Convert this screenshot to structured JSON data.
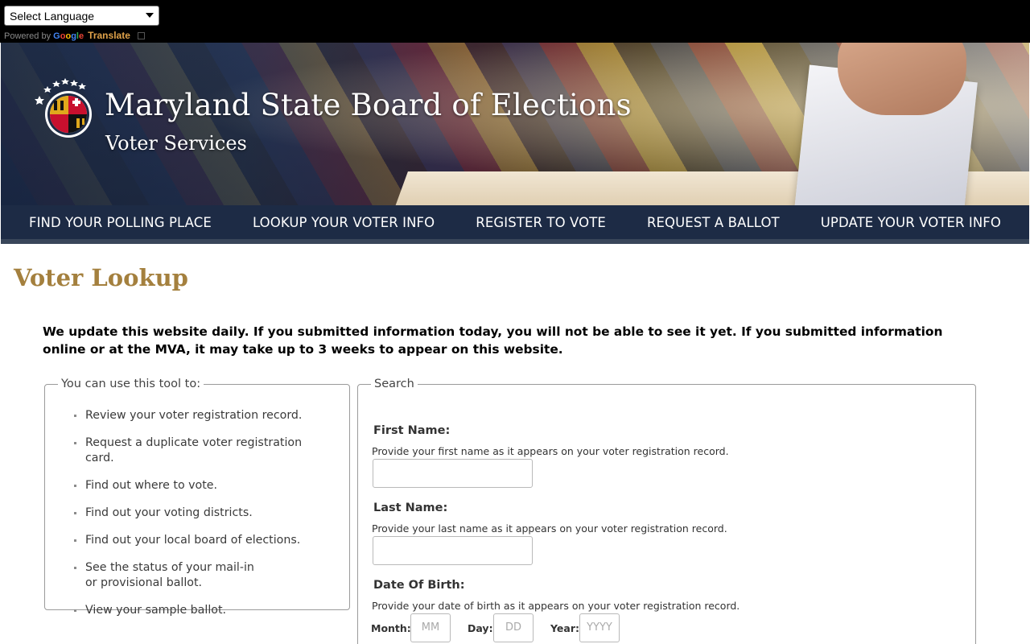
{
  "translate": {
    "select_label": "Select Language",
    "powered_by": "Powered by",
    "google": "Google",
    "translate": "Translate"
  },
  "header": {
    "title": "Maryland State Board of Elections",
    "subtitle": "Voter Services"
  },
  "nav": {
    "items": [
      {
        "label": "FIND YOUR POLLING PLACE"
      },
      {
        "label": "LOOKUP YOUR VOTER INFO"
      },
      {
        "label": "REGISTER TO VOTE"
      },
      {
        "label": "REQUEST A BALLOT"
      },
      {
        "label": "UPDATE YOUR VOTER INFO"
      }
    ]
  },
  "main": {
    "heading": "Voter Lookup",
    "notice": "We update this website daily. If you submitted information today, you will not be able to see it yet. If you submitted information online or at the MVA, it may take up to 3 weeks to appear on this website.",
    "tools": {
      "legend": "You can use this tool to:",
      "items": [
        "Review your voter registration record.",
        "Request a duplicate voter registration card.",
        "Find out where to vote.",
        "Find out your voting districts.",
        "Find out your local board of elections.",
        "See the status of your mail-in or provisional ballot.",
        "View your sample ballot."
      ]
    },
    "search": {
      "legend": "Search",
      "first_name": {
        "label": "First Name:",
        "help": "Provide your first name as it appears on your voter registration record.",
        "value": ""
      },
      "last_name": {
        "label": "Last Name:",
        "help": "Provide your last name as it appears on your voter registration record.",
        "value": ""
      },
      "dob": {
        "label": "Date Of Birth:",
        "help": "Provide your date of birth as it appears on your voter registration record.",
        "month_label": "Month:",
        "month_placeholder": "MM",
        "day_label": "Day:",
        "day_placeholder": "DD",
        "year_label": "Year:",
        "year_placeholder": "YYYY"
      }
    }
  },
  "colors": {
    "nav_bg": "#1d2b45",
    "heading": "#a4803e",
    "translate_accent": "#e0a24a"
  }
}
